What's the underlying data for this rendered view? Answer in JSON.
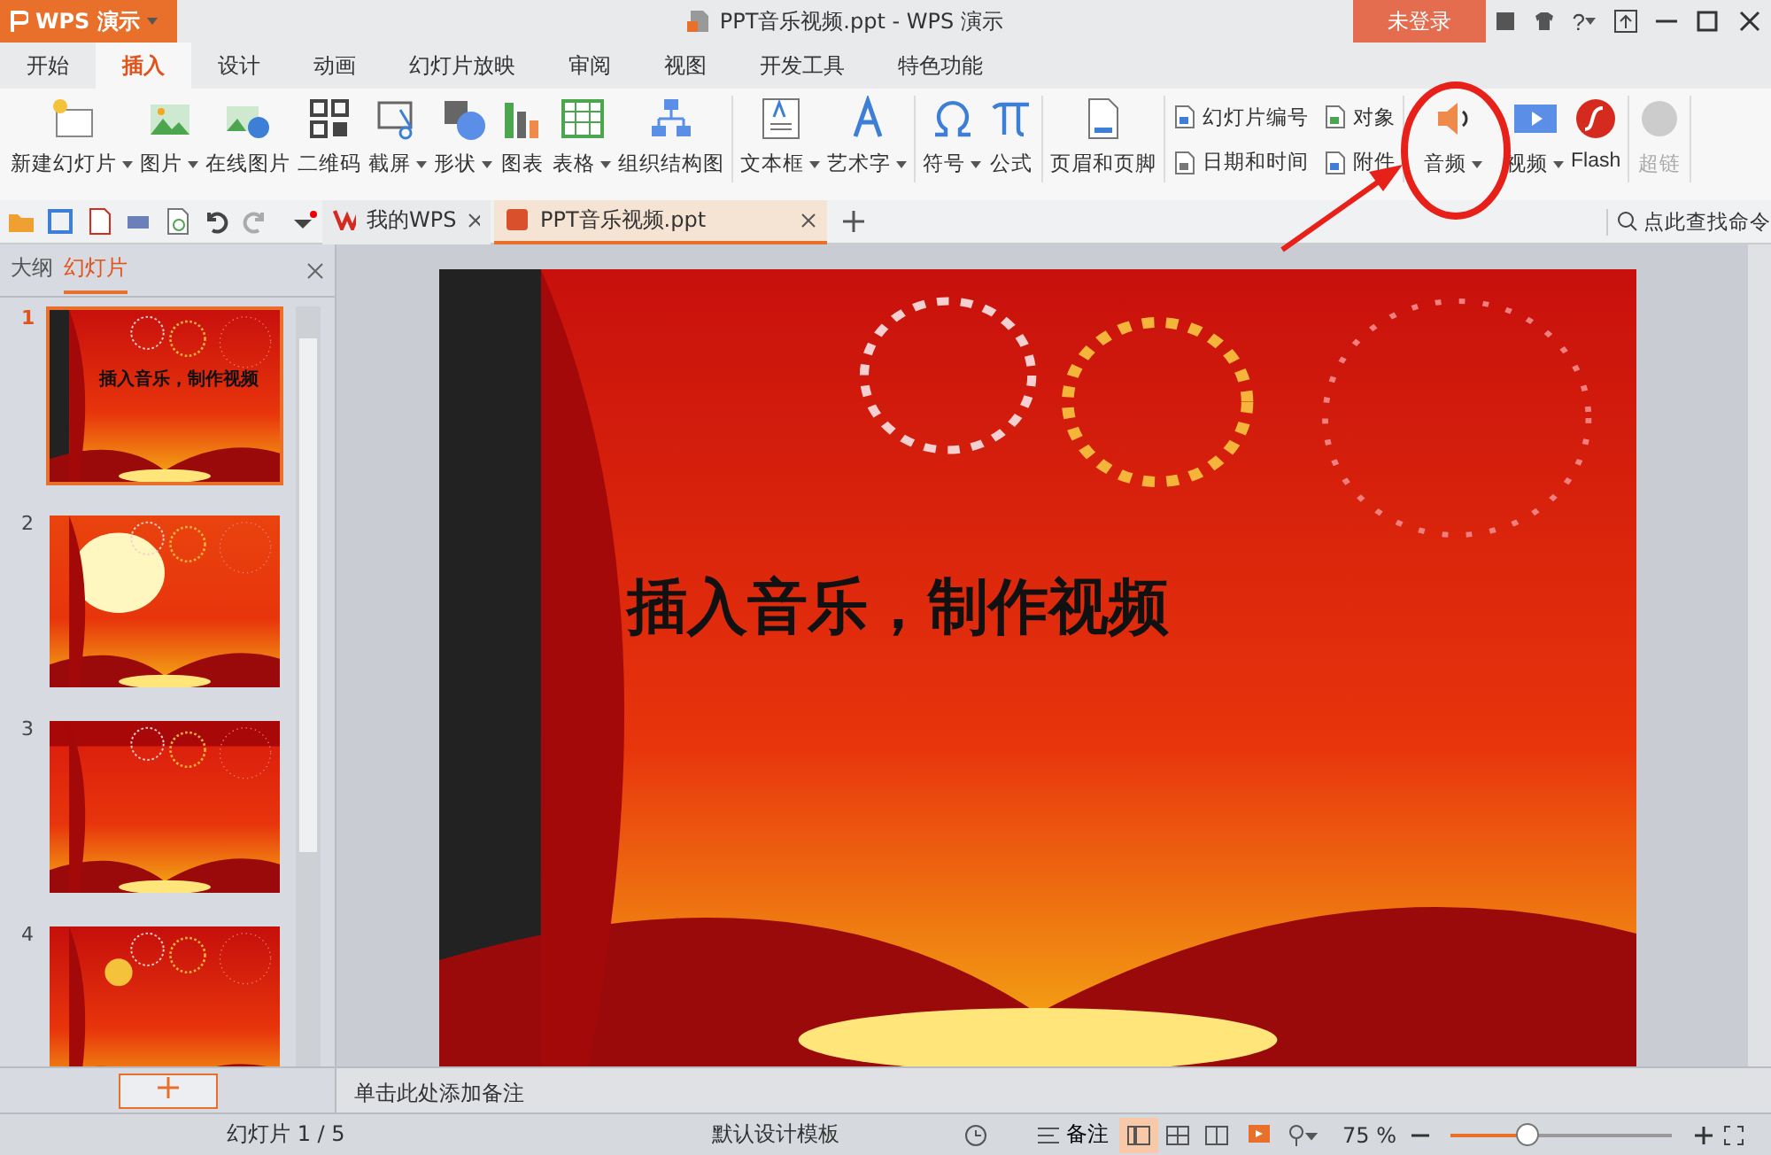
{
  "app_button": {
    "label": "WPS 演示"
  },
  "window": {
    "title": "PPT音乐视频.ppt - WPS 演示"
  },
  "login_button": {
    "label": "未登录"
  },
  "help": {
    "label": "?"
  },
  "menu_tabs": [
    {
      "label": "开始",
      "selected": false
    },
    {
      "label": "插入",
      "selected": true
    },
    {
      "label": "设计",
      "selected": false
    },
    {
      "label": "动画",
      "selected": false
    },
    {
      "label": "幻灯片放映",
      "selected": false
    },
    {
      "label": "审阅",
      "selected": false
    },
    {
      "label": "视图",
      "selected": false
    },
    {
      "label": "开发工具",
      "selected": false
    },
    {
      "label": "特色功能",
      "selected": false
    }
  ],
  "ribbon": {
    "groups": [
      {
        "kind": "large",
        "items": [
          {
            "label": "新建幻灯片",
            "dropdown": true,
            "disabled": false
          },
          {
            "label": "图片",
            "dropdown": true,
            "disabled": false
          },
          {
            "label": "在线图片",
            "dropdown": false,
            "disabled": false
          },
          {
            "label": "二维码",
            "dropdown": false,
            "disabled": false
          },
          {
            "label": "截屏",
            "dropdown": true,
            "disabled": false
          },
          {
            "label": "形状",
            "dropdown": true,
            "disabled": false
          },
          {
            "label": "图表",
            "dropdown": false,
            "disabled": false
          },
          {
            "label": "表格",
            "dropdown": true,
            "disabled": false
          },
          {
            "label": "组织结构图",
            "dropdown": false,
            "disabled": false
          }
        ]
      },
      {
        "kind": "large",
        "items": [
          {
            "label": "文本框",
            "dropdown": true,
            "disabled": false
          },
          {
            "label": "艺术字",
            "dropdown": true,
            "disabled": false
          }
        ]
      },
      {
        "kind": "large",
        "items": [
          {
            "label": "符号",
            "dropdown": true,
            "disabled": false
          },
          {
            "label": "公式",
            "dropdown": false,
            "disabled": false
          }
        ]
      },
      {
        "kind": "large",
        "items": [
          {
            "label": "页眉和页脚",
            "dropdown": false,
            "disabled": false
          }
        ]
      },
      {
        "kind": "small",
        "items": [
          {
            "label": "幻灯片编号"
          },
          {
            "label": "对象"
          },
          {
            "label": "日期和时间"
          },
          {
            "label": "附件"
          }
        ]
      },
      {
        "kind": "large",
        "items": [
          {
            "label": "音频",
            "dropdown": true,
            "disabled": false
          },
          {
            "label": "视频",
            "dropdown": true,
            "disabled": false
          },
          {
            "label": "Flash",
            "dropdown": false,
            "disabled": false
          }
        ]
      },
      {
        "kind": "large",
        "items": [
          {
            "label": "超链",
            "dropdown": false,
            "disabled": true
          }
        ]
      }
    ]
  },
  "doc_tabs": [
    {
      "label": "我的WPS",
      "selected": false
    },
    {
      "label": "PPT音乐视频.ppt",
      "selected": true
    }
  ],
  "command_search": {
    "placeholder": "点此查找命令"
  },
  "panel": {
    "tabs": [
      {
        "label": "大纲",
        "selected": false
      },
      {
        "label": "幻灯片",
        "selected": true
      }
    ],
    "slides": [
      {
        "number": "1",
        "selected": true,
        "title": "插入音乐，制作视频"
      },
      {
        "number": "2",
        "selected": false
      },
      {
        "number": "3",
        "selected": false
      },
      {
        "number": "4",
        "selected": false
      }
    ]
  },
  "slide": {
    "title": "插入音乐，制作视频"
  },
  "notes": {
    "placeholder": "单击此处添加备注"
  },
  "status_bar": {
    "slide_count": "幻灯片 1 / 5",
    "template": "默认设计模板",
    "notes_label": "备注",
    "views": [
      {
        "selected": true
      },
      {
        "selected": false
      },
      {
        "selected": false
      }
    ],
    "zoom": "75 %",
    "zoom_level": {
      "level": 0.35
    }
  }
}
